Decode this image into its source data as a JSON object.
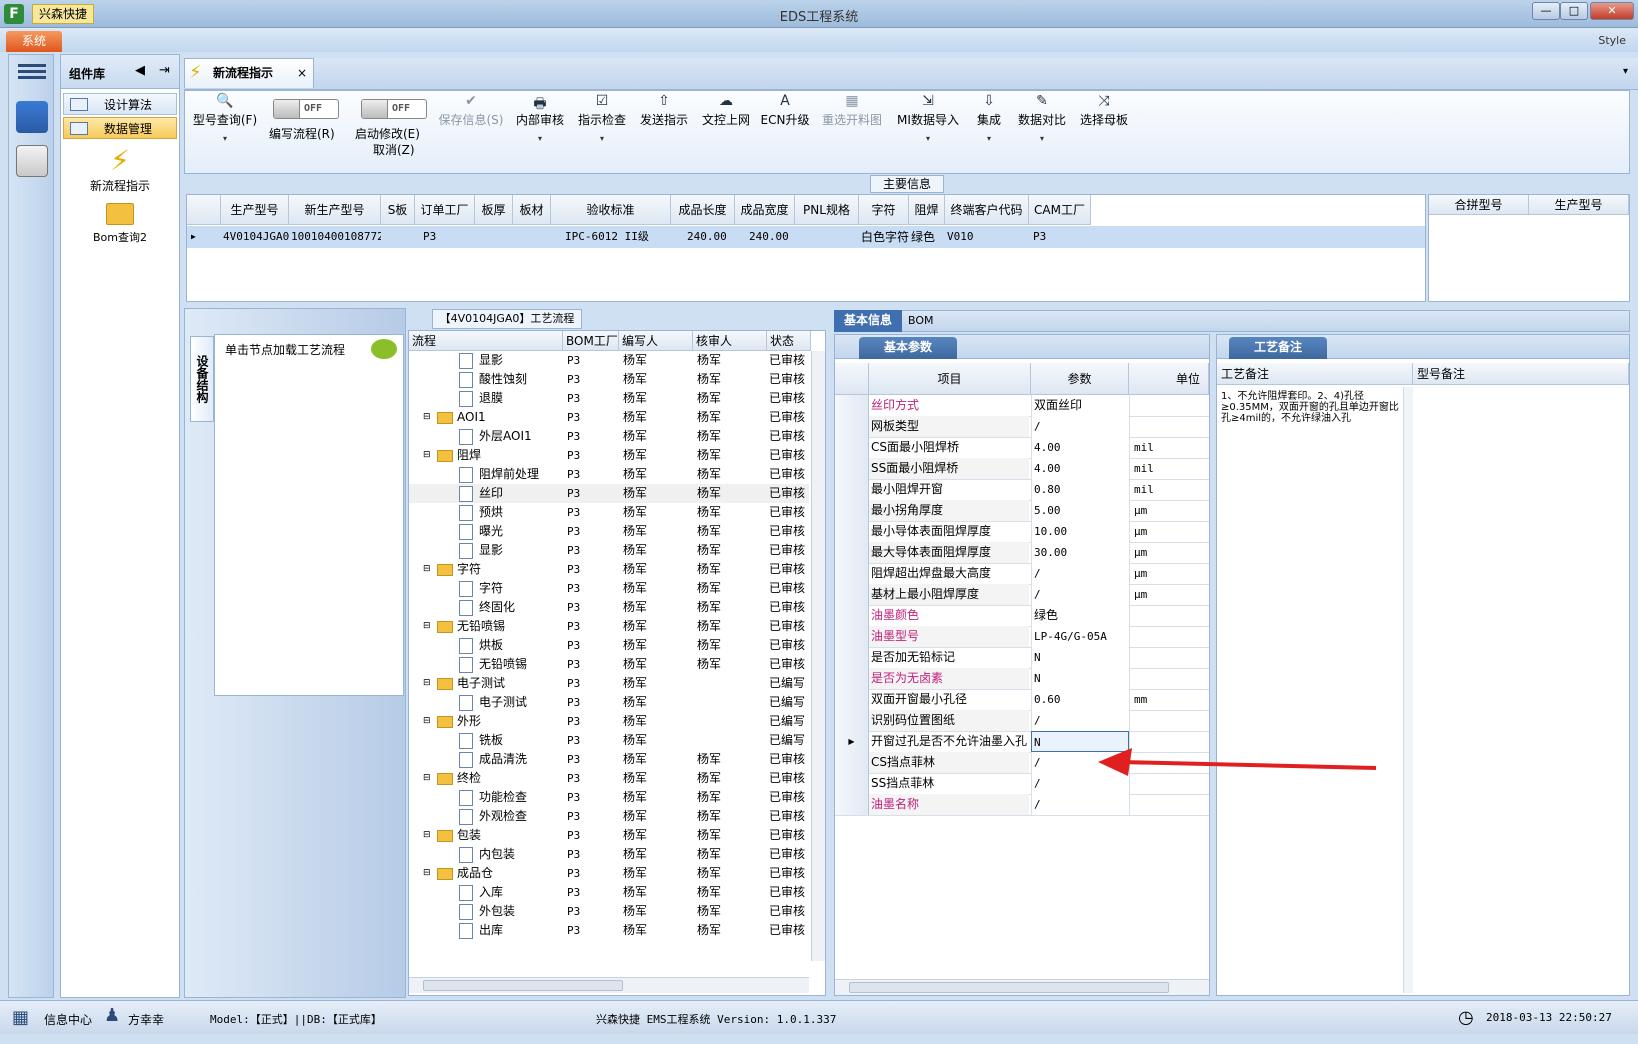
{
  "window": {
    "app_name": "兴森快捷",
    "title": "EDS工程系统",
    "min": "—",
    "max": "□",
    "close": "✕"
  },
  "menubar": {
    "system": "系统",
    "style": "Style"
  },
  "component_lib": {
    "title": "组件库",
    "nav": [
      {
        "label": "设计算法"
      },
      {
        "label": "数据管理"
      }
    ],
    "links": [
      {
        "label": "新流程指示"
      },
      {
        "label": "Bom查询2"
      }
    ]
  },
  "doc_tab": {
    "label": "新流程指示",
    "close": "×"
  },
  "ribbon": {
    "buttons": [
      {
        "label": "型号查询(F)",
        "icon": "🔍"
      },
      {
        "label": "保存信息(S)",
        "icon": "✔"
      },
      {
        "label": "内部审核",
        "icon": "🖶"
      },
      {
        "label": "指示检查",
        "icon": "☑"
      },
      {
        "label": "发送指示",
        "icon": "⇧"
      },
      {
        "label": "文控上网",
        "icon": "☁"
      },
      {
        "label": "ECN升级",
        "icon": "A"
      },
      {
        "label": "重选开料图",
        "icon": "▦"
      },
      {
        "label": "MI数据导入",
        "icon": "⇲"
      },
      {
        "label": "集成",
        "icon": "⇩"
      },
      {
        "label": "数据对比",
        "icon": "✎"
      },
      {
        "label": "选择母板",
        "icon": "⤨"
      }
    ],
    "toggles": [
      {
        "state": "OFF",
        "label": "编写流程(R)"
      },
      {
        "state": "OFF",
        "label": "启动修改(E)",
        "sub": "取消(Z)"
      }
    ],
    "dropdown_glyph": "▾"
  },
  "main_info": {
    "label": "主要信息",
    "columns": [
      "生产型号",
      "新生产型号",
      "S板",
      "订单工厂",
      "板厚",
      "板材",
      "验收标准",
      "成品长度",
      "成品宽度",
      "PNL规格",
      "字符",
      "阻焊",
      "终端客户代码",
      "CAM工厂"
    ],
    "row": [
      "4V0104JGA0",
      "10010400108772",
      "",
      "P3",
      "",
      "",
      "IPC-6012 II级",
      "240.00",
      "240.00",
      "",
      "白色字符",
      "绿色",
      "V010",
      "P3"
    ],
    "side_columns": [
      "合拼型号",
      "生产型号"
    ]
  },
  "process": {
    "vtab": "设备结构",
    "load_hint": "单击节点加载工艺流程",
    "title": "【4V0104JGA0】工艺流程",
    "columns": [
      "流程",
      "BOM工厂",
      "编写人",
      "核审人",
      "状态"
    ],
    "rows": [
      {
        "name": "显影",
        "lvl": 2,
        "p": "P3",
        "w": "杨军",
        "r": "杨军",
        "s": "已审核"
      },
      {
        "name": "酸性蚀刻",
        "lvl": 2,
        "p": "P3",
        "w": "杨军",
        "r": "杨军",
        "s": "已审核"
      },
      {
        "name": "退膜",
        "lvl": 2,
        "p": "P3",
        "w": "杨军",
        "r": "杨军",
        "s": "已审核"
      },
      {
        "name": "AOI1",
        "lvl": 1,
        "p": "P3",
        "w": "杨军",
        "r": "杨军",
        "s": "已审核"
      },
      {
        "name": "外层AOI1",
        "lvl": 2,
        "p": "P3",
        "w": "杨军",
        "r": "杨军",
        "s": "已审核"
      },
      {
        "name": "阻焊",
        "lvl": 1,
        "p": "P3",
        "w": "杨军",
        "r": "杨军",
        "s": "已审核"
      },
      {
        "name": "阻焊前处理",
        "lvl": 2,
        "p": "P3",
        "w": "杨军",
        "r": "杨军",
        "s": "已审核"
      },
      {
        "name": "丝印",
        "lvl": 2,
        "p": "P3",
        "w": "杨军",
        "r": "杨军",
        "s": "已审核",
        "sel": true
      },
      {
        "name": "预烘",
        "lvl": 2,
        "p": "P3",
        "w": "杨军",
        "r": "杨军",
        "s": "已审核"
      },
      {
        "name": "曝光",
        "lvl": 2,
        "p": "P3",
        "w": "杨军",
        "r": "杨军",
        "s": "已审核"
      },
      {
        "name": "显影",
        "lvl": 2,
        "p": "P3",
        "w": "杨军",
        "r": "杨军",
        "s": "已审核"
      },
      {
        "name": "字符",
        "lvl": 1,
        "p": "P3",
        "w": "杨军",
        "r": "杨军",
        "s": "已审核"
      },
      {
        "name": "字符",
        "lvl": 2,
        "p": "P3",
        "w": "杨军",
        "r": "杨军",
        "s": "已审核"
      },
      {
        "name": "终固化",
        "lvl": 2,
        "p": "P3",
        "w": "杨军",
        "r": "杨军",
        "s": "已审核"
      },
      {
        "name": "无铅喷锡",
        "lvl": 1,
        "p": "P3",
        "w": "杨军",
        "r": "杨军",
        "s": "已审核"
      },
      {
        "name": "烘板",
        "lvl": 2,
        "p": "P3",
        "w": "杨军",
        "r": "杨军",
        "s": "已审核"
      },
      {
        "name": "无铅喷锡",
        "lvl": 2,
        "p": "P3",
        "w": "杨军",
        "r": "杨军",
        "s": "已审核"
      },
      {
        "name": "电子测试",
        "lvl": 1,
        "p": "P3",
        "w": "杨军",
        "r": "",
        "s": "已编写"
      },
      {
        "name": "电子测试",
        "lvl": 2,
        "p": "P3",
        "w": "杨军",
        "r": "",
        "s": "已编写"
      },
      {
        "name": "外形",
        "lvl": 1,
        "p": "P3",
        "w": "杨军",
        "r": "",
        "s": "已编写"
      },
      {
        "name": "铣板",
        "lvl": 2,
        "p": "P3",
        "w": "杨军",
        "r": "",
        "s": "已编写"
      },
      {
        "name": "成品清洗",
        "lvl": 2,
        "p": "P3",
        "w": "杨军",
        "r": "杨军",
        "s": "已审核"
      },
      {
        "name": "终检",
        "lvl": 1,
        "p": "P3",
        "w": "杨军",
        "r": "杨军",
        "s": "已审核"
      },
      {
        "name": "功能检查",
        "lvl": 2,
        "p": "P3",
        "w": "杨军",
        "r": "杨军",
        "s": "已审核"
      },
      {
        "name": "外观检查",
        "lvl": 2,
        "p": "P3",
        "w": "杨军",
        "r": "杨军",
        "s": "已审核"
      },
      {
        "name": "包装",
        "lvl": 1,
        "p": "P3",
        "w": "杨军",
        "r": "杨军",
        "s": "已审核"
      },
      {
        "name": "内包装",
        "lvl": 2,
        "p": "P3",
        "w": "杨军",
        "r": "杨军",
        "s": "已审核"
      },
      {
        "name": "成品仓",
        "lvl": 1,
        "p": "P3",
        "w": "杨军",
        "r": "杨军",
        "s": "已审核"
      },
      {
        "name": "入库",
        "lvl": 2,
        "p": "P3",
        "w": "杨军",
        "r": "杨军",
        "s": "已审核"
      },
      {
        "name": "外包装",
        "lvl": 2,
        "p": "P3",
        "w": "杨军",
        "r": "杨军",
        "s": "已审核"
      },
      {
        "name": "出库",
        "lvl": 2,
        "p": "P3",
        "w": "杨军",
        "r": "杨军",
        "s": "已审核"
      }
    ]
  },
  "info_tabs": {
    "basic": "基本信息",
    "bom": "BOM"
  },
  "params": {
    "tab": "基本参数",
    "columns": [
      "项目",
      "参数",
      "单位"
    ],
    "rows": [
      {
        "k": "丝印方式",
        "v": "双面丝印",
        "u": "",
        "red": true
      },
      {
        "k": "网板类型",
        "v": "/",
        "u": ""
      },
      {
        "k": "CS面最小阻焊桥",
        "v": "4.00",
        "u": "mil"
      },
      {
        "k": "SS面最小阻焊桥",
        "v": "4.00",
        "u": "mil"
      },
      {
        "k": "最小阻焊开窗",
        "v": "0.80",
        "u": "mil"
      },
      {
        "k": "最小拐角厚度",
        "v": "5.00",
        "u": "μm"
      },
      {
        "k": "最小导体表面阻焊厚度",
        "v": "10.00",
        "u": "μm"
      },
      {
        "k": "最大导体表面阻焊厚度",
        "v": "30.00",
        "u": "μm"
      },
      {
        "k": "阻焊超出焊盘最大高度",
        "v": "/",
        "u": "μm"
      },
      {
        "k": "基材上最小阻焊厚度",
        "v": "/",
        "u": "μm"
      },
      {
        "k": "油墨颜色",
        "v": "绿色",
        "u": "",
        "red": true
      },
      {
        "k": "油墨型号",
        "v": "LP-4G/G-05A",
        "u": "",
        "red": true
      },
      {
        "k": "是否加无铅标记",
        "v": "N",
        "u": ""
      },
      {
        "k": "是否为无卤素",
        "v": "N",
        "u": "",
        "red": true
      },
      {
        "k": "双面开窗最小孔径",
        "v": "0.60",
        "u": "mm"
      },
      {
        "k": "识别码位置图纸",
        "v": "/",
        "u": ""
      },
      {
        "k": "开窗过孔是否不允许油墨入孔",
        "v": "N",
        "u": "",
        "current": true
      },
      {
        "k": "CS挡点菲林",
        "v": "/",
        "u": ""
      },
      {
        "k": "SS挡点菲林",
        "v": "/",
        "u": ""
      },
      {
        "k": "油墨名称",
        "v": "/",
        "u": "",
        "red": true
      }
    ]
  },
  "notes": {
    "tab": "工艺备注",
    "columns": [
      "工艺备注",
      "型号备注"
    ],
    "text": "1、不允许阻焊套印。2、4)孔径≥0.35MM，双面开窗的孔且单边开窗比孔≥4mil的，不允许绿油入孔"
  },
  "status": {
    "info_center": "信息中心",
    "user": "方幸幸",
    "model": "Model:【正式】||DB:【正式库】",
    "version": "兴森快捷 EMS工程系统 Version: 1.0.1.337",
    "time": "2018-03-13 22:50:27"
  },
  "colors": {
    "accent": "#3f6fae",
    "highlight_row": "#c8dcf4",
    "red_label": "#c0207a",
    "arrow": "#e02020"
  }
}
